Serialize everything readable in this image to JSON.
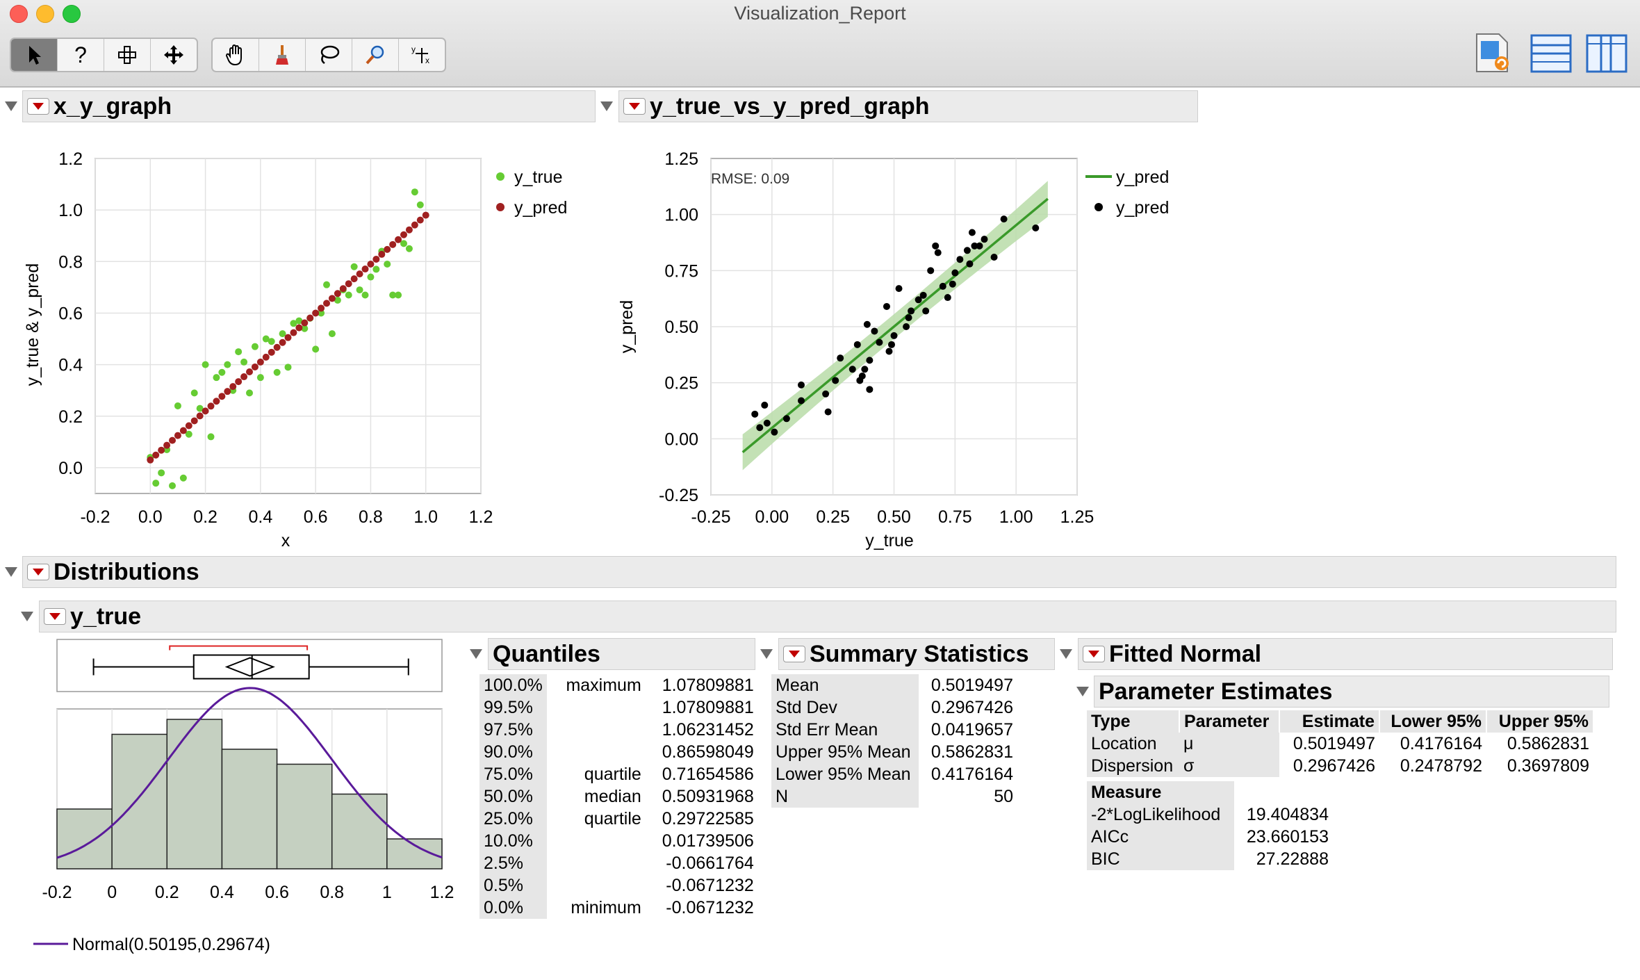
{
  "window": {
    "title": "Visualization_Report"
  },
  "xy_graph": {
    "title": "x_y_graph",
    "xlabel": "x",
    "ylabel": "y_true & y_pred",
    "legend": [
      "y_true",
      "y_pred"
    ]
  },
  "pred_graph": {
    "title": "y_true_vs_y_pred_graph",
    "xlabel": "y_true",
    "ylabel": "y_pred",
    "rmse": "RMSE: 0.09",
    "legend": [
      "y_pred",
      "y_pred"
    ]
  },
  "distributions": {
    "title": "Distributions",
    "var_title": "y_true",
    "normal_label": "Normal(0.50195,0.29674)"
  },
  "quantiles": {
    "title": "Quantiles",
    "rows": [
      [
        "100.0%",
        "maximum",
        "1.07809881"
      ],
      [
        "99.5%",
        "",
        "1.07809881"
      ],
      [
        "97.5%",
        "",
        "1.06231452"
      ],
      [
        "90.0%",
        "",
        "0.86598049"
      ],
      [
        "75.0%",
        "quartile",
        "0.71654586"
      ],
      [
        "50.0%",
        "median",
        "0.50931968"
      ],
      [
        "25.0%",
        "quartile",
        "0.29722585"
      ],
      [
        "10.0%",
        "",
        "0.01739506"
      ],
      [
        "2.5%",
        "",
        "-0.0661764"
      ],
      [
        "0.5%",
        "",
        "-0.0671232"
      ],
      [
        "0.0%",
        "minimum",
        "-0.0671232"
      ]
    ]
  },
  "summary": {
    "title": "Summary Statistics",
    "rows": [
      [
        "Mean",
        "0.5019497"
      ],
      [
        "Std Dev",
        "0.2967426"
      ],
      [
        "Std Err Mean",
        "0.0419657"
      ],
      [
        "Upper 95% Mean",
        "0.5862831"
      ],
      [
        "Lower 95% Mean",
        "0.4176164"
      ],
      [
        "N",
        "50"
      ]
    ]
  },
  "fitted_normal": {
    "title": "Fitted Normal",
    "param_title": "Parameter Estimates",
    "headers": [
      "Type",
      "Parameter",
      "Estimate",
      "Lower 95%",
      "Upper 95%"
    ],
    "rows": [
      [
        "Location",
        "μ",
        "0.5019497",
        "0.4176164",
        "0.5862831"
      ],
      [
        "Dispersion",
        "σ",
        "0.2967426",
        "0.2478792",
        "0.3697809"
      ]
    ],
    "measure_header": "Measure",
    "measures": [
      [
        "-2*LogLikelihood",
        "19.404834"
      ],
      [
        "AICc",
        "23.660153"
      ],
      [
        "BIC",
        "27.22888"
      ]
    ]
  },
  "colors": {
    "y_true": "#66cc33",
    "y_pred": "#a02020",
    "fit_line": "#3a9a2a",
    "fit_band": "#b8dca8",
    "normal_curve": "#5a1a9a",
    "hist_fill": "#c5d0c1"
  },
  "chart_data": [
    {
      "type": "scatter",
      "xlabel": "x",
      "ylabel": "y_true & y_pred",
      "xlim": [
        -0.2,
        1.2
      ],
      "ylim": [
        -0.1,
        1.2
      ],
      "xticks": [
        "-0.2",
        "0.0",
        "0.2",
        "0.4",
        "0.6",
        "0.8",
        "1.0",
        "1.2"
      ],
      "yticks": [
        "0.0",
        "0.2",
        "0.4",
        "0.6",
        "0.8",
        "1.0",
        "1.2"
      ],
      "series": [
        {
          "name": "y_true",
          "x": [
            0.0,
            0.02,
            0.04,
            0.06,
            0.08,
            0.1,
            0.12,
            0.14,
            0.16,
            0.18,
            0.2,
            0.22,
            0.24,
            0.26,
            0.28,
            0.3,
            0.32,
            0.34,
            0.36,
            0.38,
            0.4,
            0.42,
            0.44,
            0.46,
            0.48,
            0.5,
            0.52,
            0.54,
            0.56,
            0.58,
            0.6,
            0.62,
            0.64,
            0.66,
            0.68,
            0.7,
            0.72,
            0.74,
            0.76,
            0.78,
            0.8,
            0.82,
            0.84,
            0.86,
            0.88,
            0.9,
            0.92,
            0.94,
            0.96,
            0.98
          ],
          "y": [
            0.04,
            -0.06,
            -0.02,
            0.07,
            -0.07,
            0.24,
            -0.04,
            0.13,
            0.29,
            0.23,
            0.4,
            0.12,
            0.35,
            0.37,
            0.4,
            0.3,
            0.45,
            0.41,
            0.29,
            0.47,
            0.35,
            0.5,
            0.49,
            0.37,
            0.52,
            0.39,
            0.56,
            0.57,
            0.54,
            0.58,
            0.46,
            0.6,
            0.71,
            0.52,
            0.65,
            0.69,
            0.67,
            0.78,
            0.69,
            0.67,
            0.74,
            0.77,
            0.84,
            0.79,
            0.67,
            0.67,
            0.87,
            0.85,
            1.07,
            1.02
          ]
        },
        {
          "name": "y_pred",
          "x_from": 0.0,
          "x_to": 1.0,
          "n": 51,
          "slope": 0.95,
          "intercept": 0.03
        }
      ]
    },
    {
      "type": "scatter",
      "xlabel": "y_true",
      "ylabel": "y_pred",
      "xlim": [
        -0.25,
        1.25
      ],
      "ylim": [
        -0.25,
        1.25
      ],
      "xticks": [
        "-0.25",
        "0.00",
        "0.25",
        "0.50",
        "0.75",
        "1.00",
        "1.25"
      ],
      "yticks": [
        "-0.25",
        "0.00",
        "0.25",
        "0.50",
        "0.75",
        "1.00",
        "1.25"
      ],
      "fit_line": {
        "x": [
          -0.12,
          1.13
        ],
        "y": [
          -0.06,
          1.07
        ]
      },
      "series": [
        {
          "name": "y_pred",
          "x": [
            -0.07,
            -0.05,
            -0.03,
            -0.02,
            0.01,
            0.06,
            0.12,
            0.12,
            0.22,
            0.23,
            0.26,
            0.28,
            0.33,
            0.35,
            0.36,
            0.37,
            0.38,
            0.39,
            0.4,
            0.4,
            0.42,
            0.44,
            0.47,
            0.48,
            0.49,
            0.5,
            0.52,
            0.55,
            0.56,
            0.57,
            0.6,
            0.62,
            0.63,
            0.65,
            0.67,
            0.68,
            0.7,
            0.72,
            0.74,
            0.75,
            0.77,
            0.8,
            0.81,
            0.82,
            0.83,
            0.85,
            0.87,
            0.91,
            0.95,
            1.08
          ],
          "y": [
            0.11,
            0.05,
            0.15,
            0.07,
            0.03,
            0.09,
            0.17,
            0.24,
            0.2,
            0.12,
            0.26,
            0.36,
            0.31,
            0.42,
            0.26,
            0.28,
            0.31,
            0.51,
            0.22,
            0.35,
            0.48,
            0.43,
            0.59,
            0.39,
            0.42,
            0.46,
            0.67,
            0.5,
            0.54,
            0.57,
            0.62,
            0.64,
            0.57,
            0.75,
            0.86,
            0.83,
            0.68,
            0.63,
            0.69,
            0.74,
            0.8,
            0.84,
            0.78,
            0.92,
            0.86,
            0.86,
            0.89,
            0.81,
            0.98,
            0.94
          ]
        }
      ]
    },
    {
      "type": "bar",
      "title": "y_true",
      "xlim": [
        -0.2,
        1.2
      ],
      "xticks": [
        "-0.2",
        "0",
        "0.2",
        "0.4",
        "0.6",
        "0.8",
        "1",
        "1.2"
      ],
      "bin_edges": [
        -0.2,
        0.0,
        0.2,
        0.4,
        0.6,
        0.8,
        1.0,
        1.2
      ],
      "bin_counts": [
        4,
        9,
        10,
        8,
        7,
        5,
        2
      ],
      "normal_fit": {
        "mu": 0.50195,
        "sigma": 0.29674
      },
      "boxplot": {
        "min": -0.0671232,
        "q1": 0.29722585,
        "median": 0.50931968,
        "q3": 0.71654586,
        "max": 1.07809881,
        "mean": 0.5019497,
        "mean_ci": [
          0.4176164,
          0.5862831
        ],
        "shortest_half": [
          0.21,
          0.71
        ]
      }
    }
  ]
}
